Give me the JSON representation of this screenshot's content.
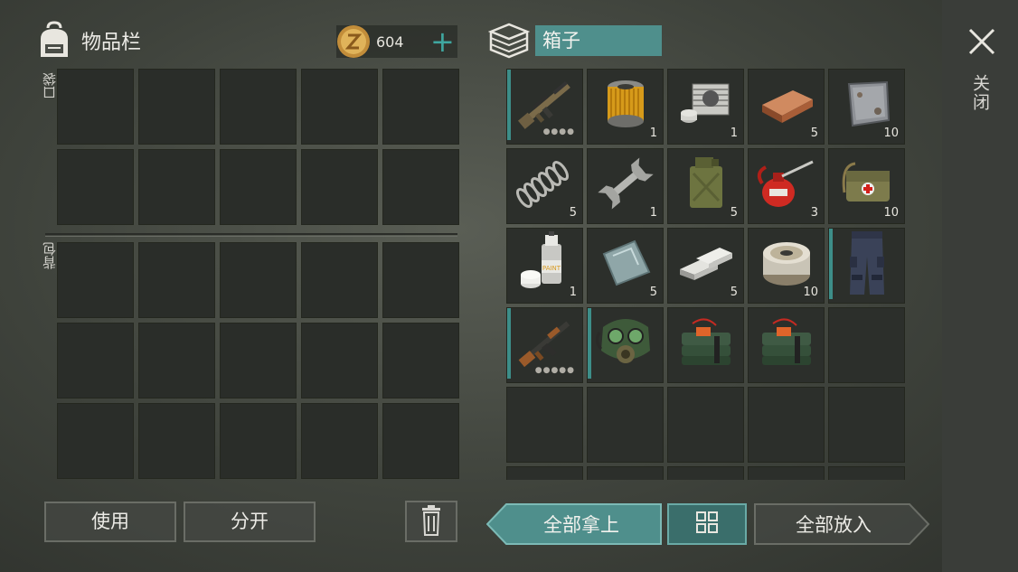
{
  "inventory": {
    "title": "物品栏",
    "pocket_label": "口袋",
    "backpack_label": "背包",
    "coins": "604"
  },
  "box": {
    "title": "箱子",
    "items": [
      {
        "name": "assault-rifle-icon",
        "qty": "",
        "dots": "●●●●",
        "accent": true
      },
      {
        "name": "oil-filter-icon",
        "qty": "1",
        "accent": false
      },
      {
        "name": "engine-cylinder-icon",
        "qty": "1",
        "accent": false
      },
      {
        "name": "copper-ingot-icon",
        "qty": "5",
        "accent": false
      },
      {
        "name": "steel-plate-icon",
        "qty": "10",
        "accent": false
      },
      {
        "name": "spring-icon",
        "qty": "5",
        "accent": false
      },
      {
        "name": "wrench-icon",
        "qty": "1",
        "accent": false
      },
      {
        "name": "jerrycan-icon",
        "qty": "5",
        "accent": false
      },
      {
        "name": "oil-can-icon",
        "qty": "3",
        "accent": false
      },
      {
        "name": "medical-bag-icon",
        "qty": "10",
        "accent": false
      },
      {
        "name": "spray-paint-icon",
        "qty": "1",
        "accent": false
      },
      {
        "name": "glass-pane-icon",
        "qty": "5",
        "accent": false
      },
      {
        "name": "aluminum-bars-icon",
        "qty": "5",
        "accent": false
      },
      {
        "name": "wire-spool-icon",
        "qty": "10",
        "accent": false
      },
      {
        "name": "tactical-pants-icon",
        "qty": "",
        "accent": true
      },
      {
        "name": "ak-rifle-icon",
        "qty": "",
        "dots": "●●●●●",
        "accent": true
      },
      {
        "name": "gas-mask-icon",
        "qty": "",
        "accent": true
      },
      {
        "name": "c4-explosive-icon",
        "qty": "",
        "accent": false
      },
      {
        "name": "c4-explosive-icon",
        "qty": "",
        "accent": false
      }
    ],
    "spray_text": "PAINT"
  },
  "close_label": "关闭",
  "buttons": {
    "use": "使用",
    "split": "分开",
    "take_all": "全部拿上",
    "put_all": "全部放入"
  },
  "colors": {
    "accent": "#3d8e89",
    "teal_button": "#4f8f8c"
  }
}
